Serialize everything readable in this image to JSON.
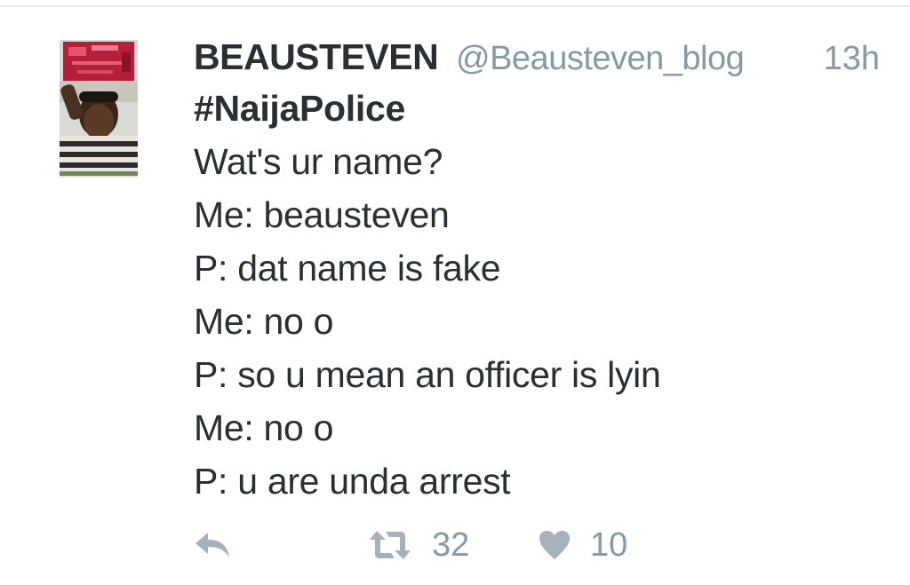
{
  "tweet": {
    "author_name": "BEAUSTEVEN",
    "author_handle": "@Beausteven_blog",
    "timestamp": "13h",
    "hashtag": "#NaijaPolice",
    "lines": [
      "Wat's ur name?",
      "Me: beausteven",
      "P: dat name is fake",
      "Me: no o",
      "P: so u mean an officer is lyin",
      "Me: no o",
      "P: u are unda arrest"
    ],
    "retweet_count": "32",
    "like_count": "10"
  },
  "icons": {
    "reply": "reply-icon",
    "retweet": "retweet-icon",
    "like": "heart-icon"
  },
  "colors": {
    "text": "#292f33",
    "muted": "#8899a6",
    "icon": "#a5b1bb",
    "divider": "#e6ecf0"
  }
}
